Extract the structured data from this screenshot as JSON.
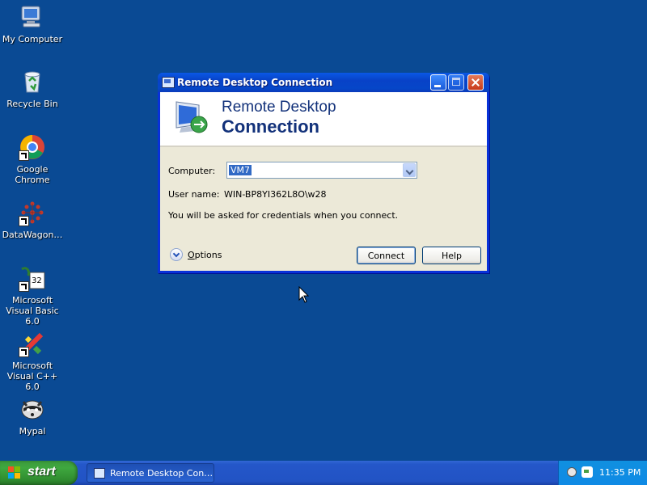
{
  "desktop": {
    "icons": [
      {
        "label": "My Computer",
        "icon": "my-computer-icon"
      },
      {
        "label": "Recycle Bin",
        "icon": "recycle-bin-icon"
      },
      {
        "label": "Google Chrome",
        "icon": "chrome-icon"
      },
      {
        "label": "DataWagon…",
        "icon": "datawagon-icon"
      },
      {
        "label": "Microsoft Visual Basic 6.0",
        "icon": "visual-basic-icon"
      },
      {
        "label": "Microsoft Visual C++ 6.0",
        "icon": "visual-cpp-icon"
      },
      {
        "label": "Mypal",
        "icon": "mypal-icon"
      }
    ]
  },
  "window": {
    "title": "Remote Desktop Connection",
    "banner_line1": "Remote Desktop",
    "banner_line2": "Connection",
    "computer_label": "Computer:",
    "computer_value": "VM7",
    "username_label": "User name:",
    "username_value": "WIN-BP8YI362L8O\\w28",
    "info_text": "You will be asked for credentials when you connect.",
    "options_label": "Options",
    "connect_label": "Connect",
    "help_label": "Help"
  },
  "taskbar": {
    "start_label": "start",
    "task_label": "Remote Desktop Con…",
    "clock": "11:35 PM"
  },
  "colors": {
    "desktop": "#0a4a94",
    "titlebar": "#0842c7",
    "taskbar": "#2457c9",
    "start": "#3fa83f"
  }
}
